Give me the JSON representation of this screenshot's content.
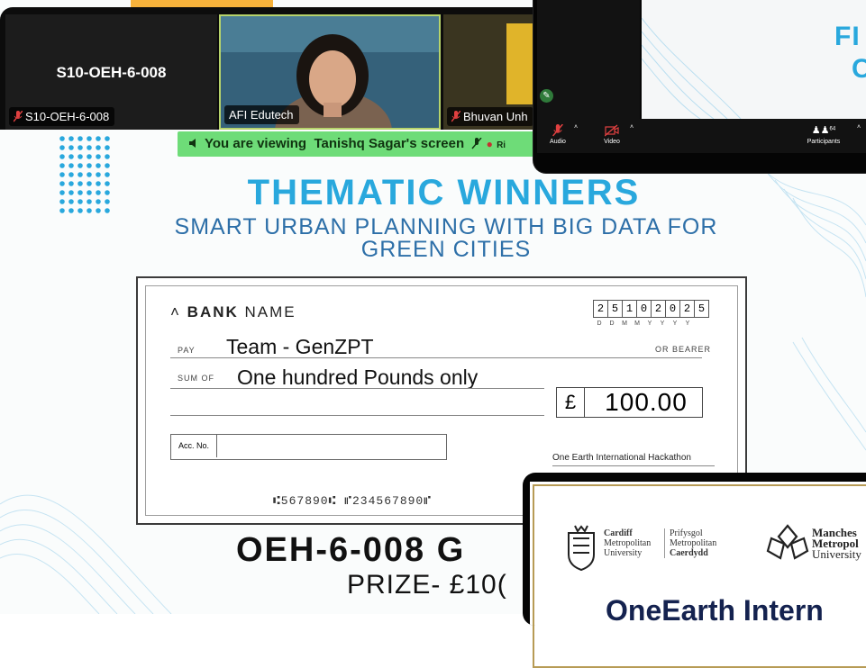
{
  "meeting": {
    "tiles": [
      {
        "title": "S10-OEH-6-008",
        "name": "S10-OEH-6-008",
        "muted": true
      },
      {
        "title": "",
        "name": "AFI Edutech",
        "muted": false
      },
      {
        "title": "",
        "name": "Bhuvan Unh",
        "muted": true
      }
    ],
    "banner_prefix": "You are viewing",
    "banner_name": "Tanishq Sagar's screen",
    "banner_tail": "Ri"
  },
  "slide": {
    "title": "THEMATIC WINNERS",
    "subtitle_line1": "SMART URBAN PLANNING WITH BIG DATA FOR",
    "subtitle_line2": "GREEN CITIES",
    "team_code": "OEH-6-008    G",
    "prize": "PRIZE- £10("
  },
  "cheque": {
    "bank_bold": "BANK",
    "bank_rest": "NAME",
    "date_digits": [
      "2",
      "5",
      "1",
      "0",
      "2",
      "0",
      "2",
      "5"
    ],
    "date_format": [
      "D",
      "D",
      "M",
      "M",
      "Y",
      "Y",
      "Y",
      "Y"
    ],
    "pay_label": "PAY",
    "payee": "Team - GenZPT",
    "or_bearer": "OR BEARER",
    "sum_label": "SUM OF",
    "sum_words": "One hundred Pounds only",
    "currency": "£",
    "amount": "100.00",
    "acc_label": "Acc. No.",
    "signatory": "One Earth International Hackathon",
    "micr": "⑆567890⑆   ⑈234567890⑈"
  },
  "zoom_overlay": {
    "preview_title_1": "FI",
    "preview_title_2": "C",
    "toolbar": {
      "audio": "Audio",
      "video": "Video",
      "participants": "Participants",
      "participants_count": "64"
    }
  },
  "certificate": {
    "uni1_line1": "Cardiff",
    "uni1_line2": "Metropolitan",
    "uni1_line3": "University",
    "uni1_welsh1": "Prifysgol",
    "uni1_welsh2": "Metropolitan",
    "uni1_welsh3": "Caerdydd",
    "uni2_line1": "Manches",
    "uni2_line2": "Metropol",
    "uni2_line3": "University",
    "title": "OneEarth Intern"
  },
  "colors": {
    "accent_blue": "#29a8dd",
    "banner_green": "#6edc78",
    "highlight_orange": "#f7b23b",
    "muted_red": "#e04040"
  }
}
